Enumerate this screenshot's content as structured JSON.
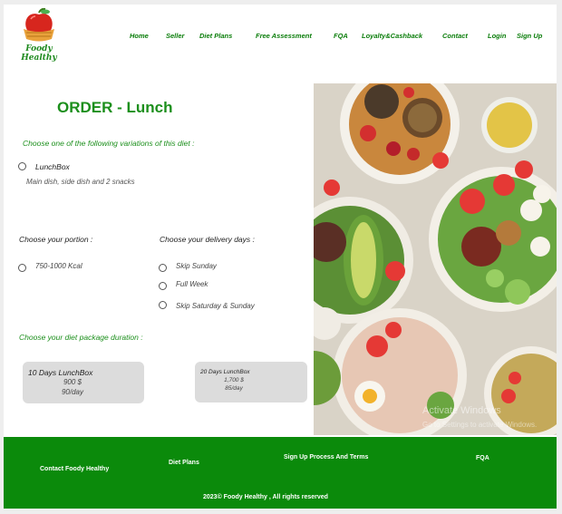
{
  "brand": {
    "name": "Foody Healthy",
    "logo_icon": "apple-basket-icon"
  },
  "nav": {
    "home": "Home",
    "seller": "Seller",
    "diet_plans": "Diet Plans",
    "free_assessment": "Free Assessment",
    "fqa": "FQA",
    "loyalty": "Loyalty&Cashback",
    "contact": "Contact",
    "login": "Login",
    "signup": "Sign Up"
  },
  "order": {
    "title": "ORDER - Lunch",
    "variation_prompt": "Choose one of the following variations of this diet :",
    "variation": {
      "label": "LunchBox",
      "description": "Main dish, side dish and 2 snacks"
    },
    "portion_prompt": "Choose your portion :",
    "portion_option": "750-1000 Kcal",
    "delivery_prompt": "Choose your delivery days :",
    "delivery_options": [
      "Skip Sunday",
      "Full Week",
      "Skip Saturday & Sunday"
    ],
    "duration_prompt": "Choose your diet package duration :",
    "packages": [
      {
        "title": "10 Days LunchBox",
        "price": "900 $",
        "per_day": "90/day"
      },
      {
        "title": "20 Days LunchBox",
        "price": "1,700 $",
        "per_day": "85/day"
      }
    ]
  },
  "hero": {
    "watermark_line1": "Activate Windows",
    "watermark_line2": "Go to Settings to activate Windows."
  },
  "footer": {
    "contact": "Contact Foody Healthy",
    "diet_plans": "Diet Plans",
    "signup_terms": "Sign Up Process And Terms",
    "fqa": "FQA",
    "copyright": "2023© Foody Healthy , All rights reserved"
  },
  "colors": {
    "brand_green": "#1c8f1c",
    "footer_green": "#0b8a0b",
    "package_bg": "#dcdcdc"
  }
}
